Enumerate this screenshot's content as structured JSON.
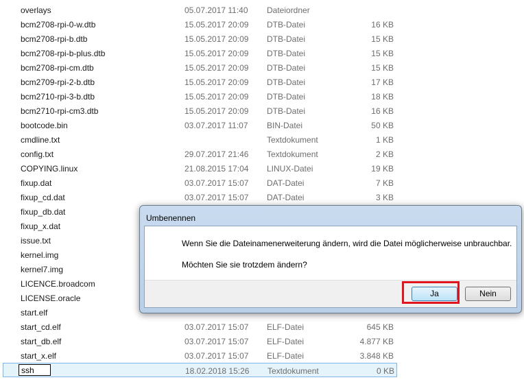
{
  "files": [
    {
      "name": "overlays",
      "date": "05.07.2017 11:40",
      "type": "Dateiordner",
      "size": ""
    },
    {
      "name": "bcm2708-rpi-0-w.dtb",
      "date": "15.05.2017 20:09",
      "type": "DTB-Datei",
      "size": "16 KB"
    },
    {
      "name": "bcm2708-rpi-b.dtb",
      "date": "15.05.2017 20:09",
      "type": "DTB-Datei",
      "size": "15 KB"
    },
    {
      "name": "bcm2708-rpi-b-plus.dtb",
      "date": "15.05.2017 20:09",
      "type": "DTB-Datei",
      "size": "15 KB"
    },
    {
      "name": "bcm2708-rpi-cm.dtb",
      "date": "15.05.2017 20:09",
      "type": "DTB-Datei",
      "size": "15 KB"
    },
    {
      "name": "bcm2709-rpi-2-b.dtb",
      "date": "15.05.2017 20:09",
      "type": "DTB-Datei",
      "size": "17 KB"
    },
    {
      "name": "bcm2710-rpi-3-b.dtb",
      "date": "15.05.2017 20:09",
      "type": "DTB-Datei",
      "size": "18 KB"
    },
    {
      "name": "bcm2710-rpi-cm3.dtb",
      "date": "15.05.2017 20:09",
      "type": "DTB-Datei",
      "size": "16 KB"
    },
    {
      "name": "bootcode.bin",
      "date": "03.07.2017 11:07",
      "type": "BIN-Datei",
      "size": "50 KB"
    },
    {
      "name": "cmdline.txt",
      "date": "",
      "type": "Textdokument",
      "size": "1 KB"
    },
    {
      "name": "config.txt",
      "date": "29.07.2017 21:46",
      "type": "Textdokument",
      "size": "2 KB"
    },
    {
      "name": "COPYING.linux",
      "date": "21.08.2015 17:04",
      "type": "LINUX-Datei",
      "size": "19 KB"
    },
    {
      "name": "fixup.dat",
      "date": "03.07.2017 15:07",
      "type": "DAT-Datei",
      "size": "7 KB"
    },
    {
      "name": "fixup_cd.dat",
      "date": "03.07.2017 15:07",
      "type": "DAT-Datei",
      "size": "3 KB"
    },
    {
      "name": "fixup_db.dat",
      "date": "",
      "type": "",
      "size": ""
    },
    {
      "name": "fixup_x.dat",
      "date": "",
      "type": "",
      "size": ""
    },
    {
      "name": "issue.txt",
      "date": "",
      "type": "",
      "size": ""
    },
    {
      "name": "kernel.img",
      "date": "",
      "type": "",
      "size": ""
    },
    {
      "name": "kernel7.img",
      "date": "",
      "type": "",
      "size": ""
    },
    {
      "name": "LICENCE.broadcom",
      "date": "",
      "type": "",
      "size": ""
    },
    {
      "name": "LICENSE.oracle",
      "date": "",
      "type": "",
      "size": ""
    },
    {
      "name": "start.elf",
      "date": "",
      "type": "",
      "size": ""
    },
    {
      "name": "start_cd.elf",
      "date": "03.07.2017 15:07",
      "type": "ELF-Datei",
      "size": "645 KB"
    },
    {
      "name": "start_db.elf",
      "date": "03.07.2017 15:07",
      "type": "ELF-Datei",
      "size": "4.877 KB"
    },
    {
      "name": "start_x.elf",
      "date": "03.07.2017 15:07",
      "type": "ELF-Datei",
      "size": "3.848 KB"
    }
  ],
  "selected_file": {
    "rename_value": "ssh",
    "date": "18.02.2018 15:26",
    "type": "Textdokument",
    "size": "0 KB"
  },
  "dialog": {
    "title": "Umbenennen",
    "message": "Wenn Sie die Dateinamenerweiterung ändern, wird die Datei möglicherweise unbrauchbar.",
    "question": "Möchten Sie sie trotzdem ändern?",
    "yes_label": "Ja",
    "no_label": "Nein"
  },
  "colors": {
    "highlight": "#e0141e",
    "selection_bg": "#e5f3fb"
  }
}
